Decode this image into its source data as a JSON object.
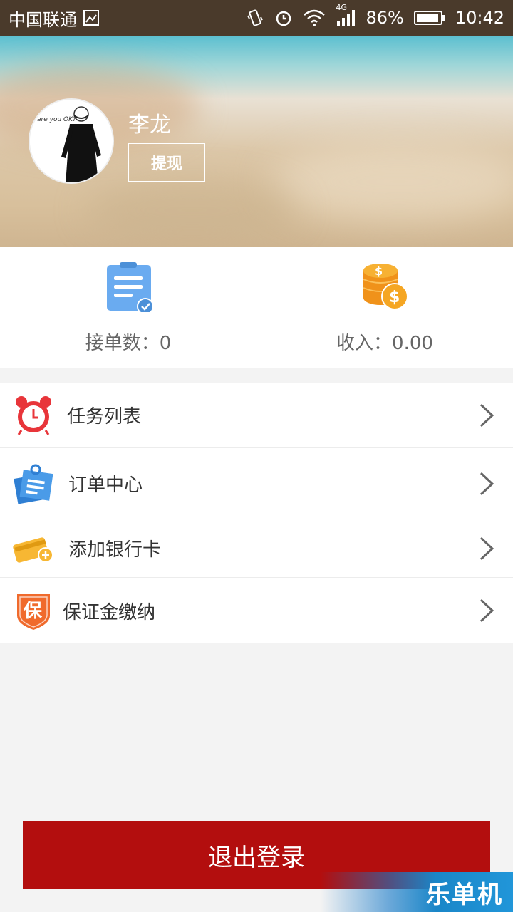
{
  "status_bar": {
    "carrier": "中国联通",
    "network": "4G",
    "battery": "86%",
    "time": "10:42",
    "icons": [
      "image-icon",
      "vibrate-icon",
      "alarm-icon",
      "wifi-icon",
      "signal-icon",
      "battery-icon"
    ]
  },
  "profile": {
    "name": "李龙",
    "withdraw_label": "提现",
    "avatar_caption": "are you OK?"
  },
  "stats": {
    "orders_label": "接单数：0",
    "income_label": "收入：0.00"
  },
  "menu": {
    "items": [
      {
        "label": "任务列表",
        "icon": "alarm-clock-icon"
      },
      {
        "label": "订单中心",
        "icon": "order-notes-icon"
      },
      {
        "label": "添加银行卡",
        "icon": "bank-card-icon"
      },
      {
        "label": "保证金缴纳",
        "icon": "deposit-shield-icon",
        "icon_text": "保"
      }
    ]
  },
  "logout_label": "退出登录",
  "watermark": "乐单机",
  "colors": {
    "status_bar": "#4a3a2b",
    "logout": "#b30e0e",
    "orders_icon": "#6aabf0",
    "income_icon": "#f5a623",
    "alarm_icon": "#e8353a",
    "card_icon": "#f7b733",
    "shield_icon": "#f06a2c"
  }
}
